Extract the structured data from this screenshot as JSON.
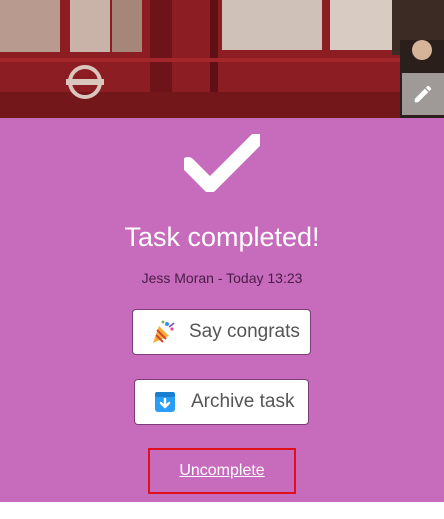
{
  "header": {
    "photo_icon": "bus-photo",
    "edit_icon": "pencil-icon"
  },
  "task": {
    "status_icon": "checkmark-icon",
    "title": "Task completed!",
    "meta": "Jess Moran - Today 13:23"
  },
  "actions": {
    "congrats_label": "Say congrats",
    "congrats_icon": "party-popper-icon",
    "archive_label": "Archive task",
    "archive_icon": "archive-box-icon",
    "uncomplete_label": "Uncomplete"
  },
  "colors": {
    "panel": "#c76bbd",
    "highlight_border": "#e0101c",
    "archive_icon": "#2a9df4"
  }
}
